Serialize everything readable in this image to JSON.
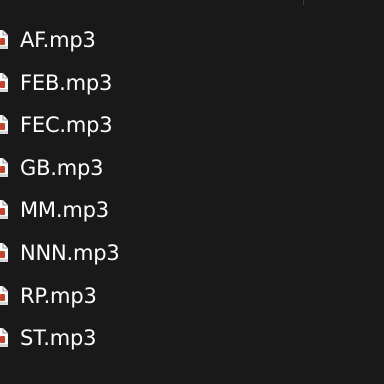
{
  "theme": {
    "background": "#191919",
    "text": "#ffffff",
    "icon_fill": "#ffffff",
    "icon_accent": "#c6422f"
  },
  "files": [
    {
      "name": "AF.mp3",
      "icon": "audio-file-icon"
    },
    {
      "name": "FEB.mp3",
      "icon": "audio-file-icon"
    },
    {
      "name": "FEC.mp3",
      "icon": "audio-file-icon"
    },
    {
      "name": "GB.mp3",
      "icon": "audio-file-icon"
    },
    {
      "name": "MM.mp3",
      "icon": "audio-file-icon"
    },
    {
      "name": "NNN.mp3",
      "icon": "audio-file-icon"
    },
    {
      "name": "RP.mp3",
      "icon": "audio-file-icon"
    },
    {
      "name": "ST.mp3",
      "icon": "audio-file-icon"
    }
  ]
}
